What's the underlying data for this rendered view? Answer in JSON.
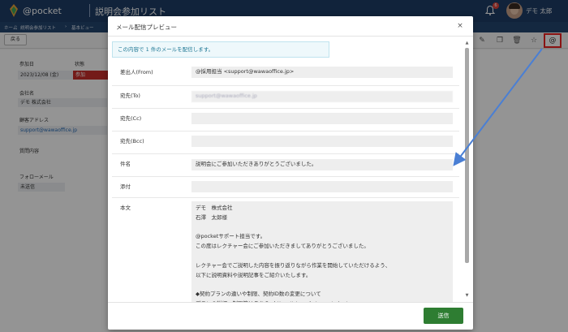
{
  "app": {
    "logo": "@pocket",
    "page_title": "説明会参加リスト",
    "notification_count": "6",
    "user_name": "デモ 太郎",
    "breadcrumb": [
      "ホーム",
      "説明会参加リスト",
      "基本ビュー"
    ],
    "toolbar": {
      "back_label": "戻る",
      "mail_icon": "@"
    }
  },
  "detail": {
    "fields": [
      {
        "label": "参加日",
        "value": "2023/12/08 (金)"
      },
      {
        "label": "状態",
        "value": "参加"
      },
      {
        "label": "会社名",
        "value": "デモ 株式会社"
      },
      {
        "label": "顧客アドレス",
        "value": "support@wawaoffice.jp"
      },
      {
        "label": "質問内容",
        "value": ""
      },
      {
        "label": "フォローメール",
        "value": "未送信"
      }
    ]
  },
  "modal": {
    "title": "メール配信プレビュー",
    "close_icon": "×",
    "info": "この内容で 1 件のメールを配信します。",
    "from_label": "差出人(From)",
    "from_value": "@採用担当 <support@wawaoffice.jp>",
    "to_label": "宛先(To)",
    "to_value": "support@wawaoffice.jp",
    "cc_label": "宛先(Cc)",
    "cc_value": "",
    "bcc_label": "宛先(Bcc)",
    "bcc_value": "",
    "subject_label": "件名",
    "subject_value": "説明会にご参加いただきありがとうございました。",
    "attach_label": "添付",
    "attach_value": "",
    "body_label": "本文",
    "body_value": "デモ　株式会社\n石澤　太郎様\n\n@pocketサポート担当です。\nこの度はレクチャー会にご参加いただきましてありがとうございました。\n\nレクチャー会でご説明した内容を振り返りながら作業を開始していただけるよう、\n以下に説明資料や説明記事をご紹介いたします。\n\n◆契約プランの違いや制限、契約ID数の変更について\nプランの詳細、制限等はこちら→https://at-pocket.com/price/\nID変更やプラン変更をする場合の説明記事はこちら→https://support.wawaoffice.jp/atpocket/faq/10117/",
    "send_label": "送信"
  },
  "colors": {
    "topbar": "#1e3d66",
    "send_button": "#2e7d32",
    "status_badge": "#c9302c",
    "highlight": "#e22222",
    "arrow": "#4a7fd4"
  }
}
